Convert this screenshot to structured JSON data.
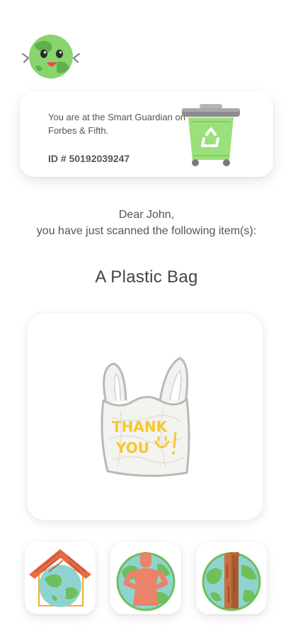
{
  "location": {
    "line": "You are at the Smart Guardian on Forbes & Fifth.",
    "id_label": "ID # 50192039247"
  },
  "greeting": {
    "salutation": "Dear John,",
    "message": "you have just scanned the following item(s):"
  },
  "item": {
    "title": "A Plastic Bag",
    "bag_text_line1": "THANK",
    "bag_text_line2": "YOU"
  },
  "colors": {
    "earth_green": "#7fcf6a",
    "ocean_blue": "#8fd3d0",
    "roof_orange": "#e76b43",
    "person_orange": "#e9836a",
    "trunk_brown": "#c86f3e",
    "bag_yellow": "#f6c72e",
    "bin_green": "#9be07a"
  },
  "icons": {
    "mascot": "earth-mascot-icon",
    "bin": "recycling-bin-icon",
    "tile_home": "earth-home-icon",
    "tile_person": "earth-person-icon",
    "tile_tree": "earth-tree-icon"
  }
}
